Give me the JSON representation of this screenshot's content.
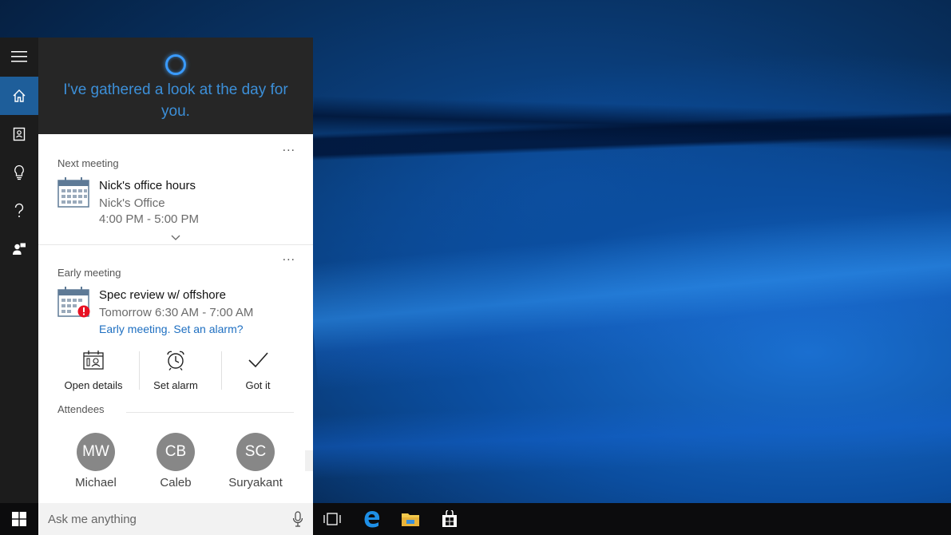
{
  "cortana": {
    "greeting": "I've gathered a look at the day for you.",
    "nav": [
      "menu-icon",
      "home-icon",
      "notebook-icon",
      "lightbulb-icon",
      "help-icon",
      "feedback-icon"
    ],
    "next_meeting": {
      "label": "Next meeting",
      "menu": "...",
      "title": "Nick's office hours",
      "location": "Nick's Office",
      "time": "4:00 PM - 5:00 PM"
    },
    "early_meeting": {
      "label": "Early meeting",
      "menu": "...",
      "title": "Spec review w/ offshore",
      "time": "Tomorrow 6:30 AM - 7:00 AM",
      "alert_link": "Early meeting. Set an alarm?",
      "actions": [
        {
          "label": "Open details",
          "icon": "open-details-icon"
        },
        {
          "label": "Set alarm",
          "icon": "alarm-clock-icon"
        },
        {
          "label": "Got it",
          "icon": "checkmark-icon"
        }
      ],
      "attendees_label": "Attendees",
      "attendees": [
        {
          "initials": "MW",
          "name": "Michael"
        },
        {
          "initials": "CB",
          "name": "Caleb"
        },
        {
          "initials": "SC",
          "name": "Suryakant"
        }
      ]
    }
  },
  "taskbar": {
    "search_placeholder": "Ask me anything",
    "icons": [
      "windows-start-icon",
      "mic-icon",
      "task-view-icon",
      "edge-icon",
      "file-explorer-icon",
      "store-icon"
    ]
  },
  "colors": {
    "accent": "#3c8fd8",
    "link": "#1e6fc1",
    "rail_active": "#1e5e9a",
    "header_bg": "#262626",
    "avatar_bg": "#878787"
  }
}
